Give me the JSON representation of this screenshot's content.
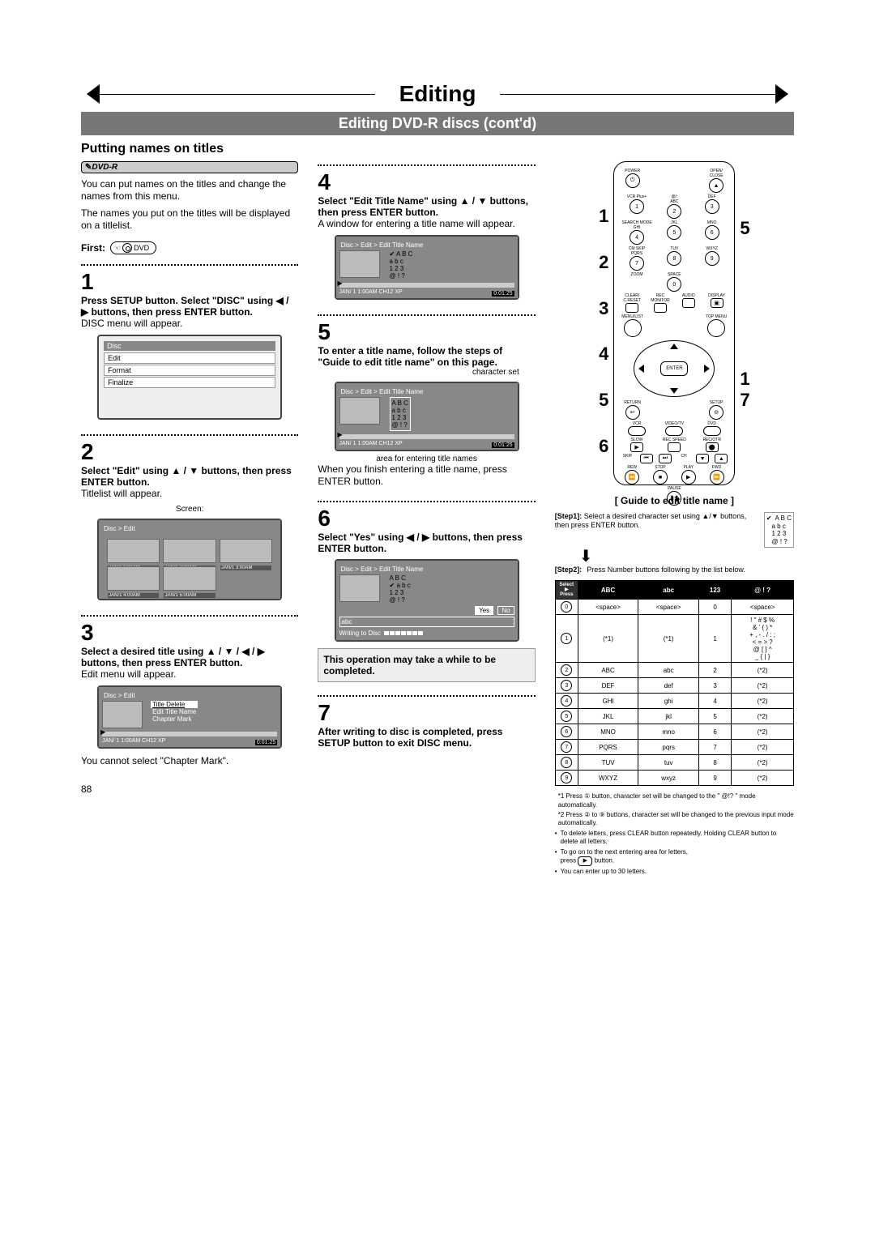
{
  "chapter": "Editing",
  "sub_banner": "Editing DVD-R discs (cont'd)",
  "section": "Putting names on titles",
  "disc_badge": "DVD-R",
  "intro1": "You can put names on the titles and change the names from this menu.",
  "intro2": "The names you put on the titles will be displayed on a titlelist.",
  "first_label": "First:",
  "dvd_btn": "DVD",
  "steps": {
    "s1": {
      "num": "1",
      "head": "Press SETUP button. Select \"DISC\" using ◀ / ▶ buttons, then press ENTER button.",
      "tail": "DISC menu will appear.",
      "screen_title": "Disc",
      "items": [
        "Edit",
        "Format",
        "Finalize"
      ]
    },
    "s2": {
      "num": "2",
      "head": "Select \"Edit\" using ▲ / ▼ buttons, then press ENTER button.",
      "tail": "Titlelist will appear.",
      "screen_label": "Screen:",
      "breadcrumb": "Disc > Edit",
      "thumbs": [
        "JAN/1  1:00AM",
        "JAN/1  2:00AM",
        "JAN/1  3:00AM",
        "JAN/1  4:00AM",
        "JAN/1  5:00AM"
      ]
    },
    "s3": {
      "num": "3",
      "head": "Select a desired title using ▲ / ▼ / ◀ / ▶ buttons, then press ENTER button.",
      "tail": "Edit menu will appear.",
      "breadcrumb": "Disc > Edit",
      "menu": [
        "Title Delete",
        "Edit Title Name",
        "Chapter Mark"
      ],
      "status": "JAN/ 1   1:00AM  CH12    XP",
      "timer": "0:01:25",
      "note": "You cannot select \"Chapter Mark\"."
    },
    "s4": {
      "num": "4",
      "head": "Select \"Edit Title Name\" using ▲ / ▼ buttons, then press ENTER button.",
      "tail": "A window for entering a title name will appear.",
      "breadcrumb": "Disc > Edit > Edit Title Name",
      "charset": [
        "A B C",
        "a b c",
        "1 2 3",
        "@ ! ?"
      ],
      "status": "JAN/ 1   1:00AM   CH12   XP",
      "timer": "0:01:25"
    },
    "s5": {
      "num": "5",
      "head": "To enter a title name, follow the steps of \"Guide to edit title name\" on this page.",
      "char_label": "character set",
      "breadcrumb": "Disc > Edit > Edit Title Name",
      "charset": [
        "A B C",
        "a b c",
        "1 2 3",
        "@ ! ?"
      ],
      "status": "JAN/ 1   1:00AM   CH12   XP",
      "timer": "0:01:25",
      "area_label": "area for entering title names",
      "tail": "When you finish entering a title name, press ENTER button."
    },
    "s6": {
      "num": "6",
      "head": "Select \"Yes\" using ◀ / ▶ buttons, then press ENTER button.",
      "breadcrumb": "Disc > Edit > Edit Title Name",
      "charset": [
        "A B C",
        "a b c",
        "1 2 3",
        "@ ! ?"
      ],
      "yes": "Yes",
      "no": "No",
      "entered": "abc",
      "writing": "Writing to Disc",
      "note": "This operation may take a while to be completed."
    },
    "s7": {
      "num": "7",
      "head": "After writing to disc is completed, press SETUP button to exit DISC menu."
    }
  },
  "remote_side_left": [
    "1",
    "2",
    "3",
    "4",
    "5",
    "6"
  ],
  "remote_side_right_top": "5",
  "remote_side_right_bot": [
    "1",
    "7"
  ],
  "remote_labels": {
    "power": "POWER",
    "open": "OPEN/\nCLOSE",
    "vcr": "VCR Plus+",
    "at": "@/:",
    "abc": "ABC",
    "def": "DEF",
    "search": "SEARCH\nMODE",
    "ghi": "GHI",
    "jkl": "JKL",
    "mno": "MNO",
    "cm": "CM SKIP",
    "pqrs": "PQRS",
    "tuv": "TUV",
    "wxyz": "WXYZ",
    "zoom": "ZOOM",
    "space": "SPACE",
    "clear": "CLEAR/\nC.RESET",
    "recmon": "REC\nMONITOR",
    "audio": "AUDIO",
    "display": "DISPLAY",
    "menulist": "MENU/LIST",
    "topmenu": "TOP MENU",
    "enter": "ENTER",
    "return": "RETURN",
    "setup": "SETUP",
    "vcr2": "VCR",
    "vdtv": "VIDEO/TV",
    "dvd2": "DVD",
    "slow": "SLOW",
    "recsp": "REC\nSPEED",
    "recotr": "REC/OTR",
    "skipn": "SKIP",
    "ch": "CH",
    "rew": "REW",
    "stop": "STOP",
    "play": "PLAY",
    "fwd": "FWD",
    "pause": "PAUSE"
  },
  "guide_title": "[ Guide to edit title name ]",
  "guide_step1_lab": "[Step1]:",
  "guide_step1_txt": "Select a desired character set using ▲/▼ buttons, then press ENTER button.",
  "guide_step2_lab": "[Step2]:",
  "guide_step2_txt": "Press Number buttons following by the list below.",
  "mini_charset": [
    "✔  A B C",
    "   a b c",
    "   1 2 3",
    "   @ ! ?"
  ],
  "char_table": {
    "head": [
      "",
      "ABC",
      "abc",
      "123",
      "@ ! ?"
    ],
    "select_lab": "Select\n▶\nPress",
    "rows": [
      {
        "k": "0",
        "c": [
          "<space>",
          "<space>",
          "0",
          "<space>"
        ]
      },
      {
        "k": "1",
        "c": [
          "(*1)",
          "(*1)",
          "1",
          "! \" # $ %\n& ' ( ) *\n+ , - . / : ;\n< = > ?\n@ [ ] ^\n_ { | }"
        ]
      },
      {
        "k": "2",
        "c": [
          "ABC",
          "abc",
          "2",
          "(*2)"
        ]
      },
      {
        "k": "3",
        "c": [
          "DEF",
          "def",
          "3",
          "(*2)"
        ]
      },
      {
        "k": "4",
        "c": [
          "GHI",
          "ghi",
          "4",
          "(*2)"
        ]
      },
      {
        "k": "5",
        "c": [
          "JKL",
          "jkl",
          "5",
          "(*2)"
        ]
      },
      {
        "k": "6",
        "c": [
          "MNO",
          "mno",
          "6",
          "(*2)"
        ]
      },
      {
        "k": "7",
        "c": [
          "PQRS",
          "pqrs",
          "7",
          "(*2)"
        ]
      },
      {
        "k": "8",
        "c": [
          "TUV",
          "tuv",
          "8",
          "(*2)"
        ]
      },
      {
        "k": "9",
        "c": [
          "WXYZ",
          "wxyz",
          "9",
          "(*2)"
        ]
      }
    ]
  },
  "footnotes": {
    "n1": "*1 Press ① button, character set will be changed to the \" @!? \" mode automatically.",
    "n2": "*2 Press ② to ⑨ buttons, character set will be changed to the previous input mode automatically.",
    "b1": "To delete letters, press CLEAR button repeatedly. Holding CLEAR button to delete all letters.",
    "b2_a": "To go on to the next entering area for letters,",
    "b2_b": "press",
    "b2_c": "button.",
    "b3": "You can enter up to 30 letters."
  },
  "page_num": "88"
}
